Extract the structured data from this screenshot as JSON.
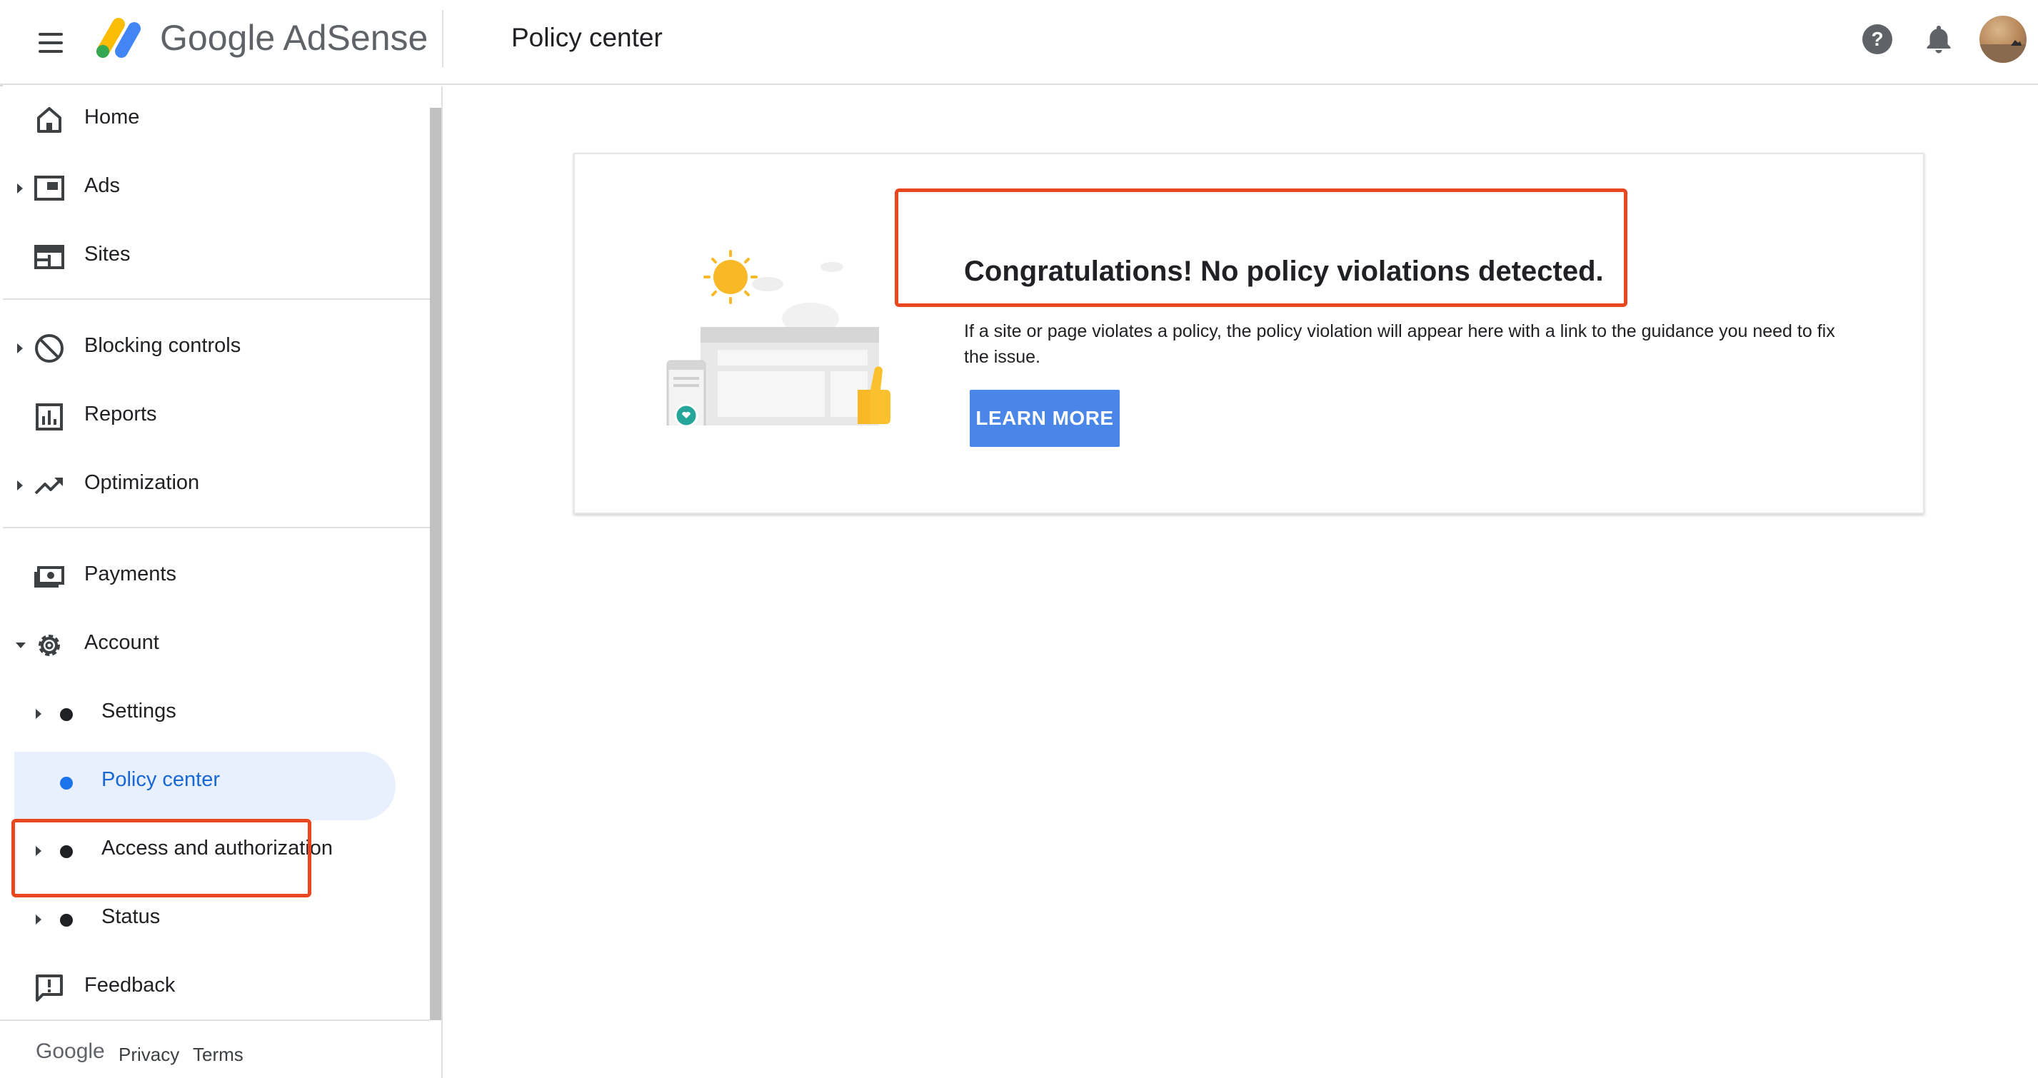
{
  "header": {
    "brand_google": "Google",
    "brand_product": "AdSense",
    "page_title": "Policy center",
    "icons": [
      "menu-icon",
      "adsense-logo",
      "help-icon",
      "notifications-icon",
      "account-avatar"
    ]
  },
  "sidebar": {
    "items": [
      {
        "label": "Home",
        "icon": "home-icon"
      },
      {
        "label": "Ads",
        "icon": "ads-icon",
        "expandable": true
      },
      {
        "label": "Sites",
        "icon": "sites-icon"
      },
      {
        "label": "Blocking controls",
        "icon": "block-icon",
        "expandable": true
      },
      {
        "label": "Reports",
        "icon": "reports-icon"
      },
      {
        "label": "Optimization",
        "icon": "trending-icon",
        "expandable": true
      },
      {
        "label": "Payments",
        "icon": "payments-icon"
      },
      {
        "label": "Account",
        "icon": "gear-icon",
        "expanded": true
      },
      {
        "label": "Settings",
        "sub": true,
        "expandable": true
      },
      {
        "label": "Policy center",
        "sub": true,
        "active": true
      },
      {
        "label": "Access and authorization",
        "sub": true,
        "expandable": true
      },
      {
        "label": "Status",
        "sub": true,
        "expandable": true
      },
      {
        "label": "Feedback",
        "icon": "feedback-icon"
      }
    ],
    "footer": {
      "google": "Google",
      "privacy": "Privacy",
      "terms": "Terms"
    }
  },
  "main": {
    "card_title": "Congratulations! No policy violations detected.",
    "card_body": "If a site or page violates a policy, the policy violation will appear here with a link to the guidance you need to fix the issue.",
    "learn_more": "LEARN MORE"
  },
  "colors": {
    "accent": "#1a73e8",
    "active_bg": "#e8f0fe",
    "button": "#4a86e8",
    "highlight_box": "#e8471f"
  }
}
